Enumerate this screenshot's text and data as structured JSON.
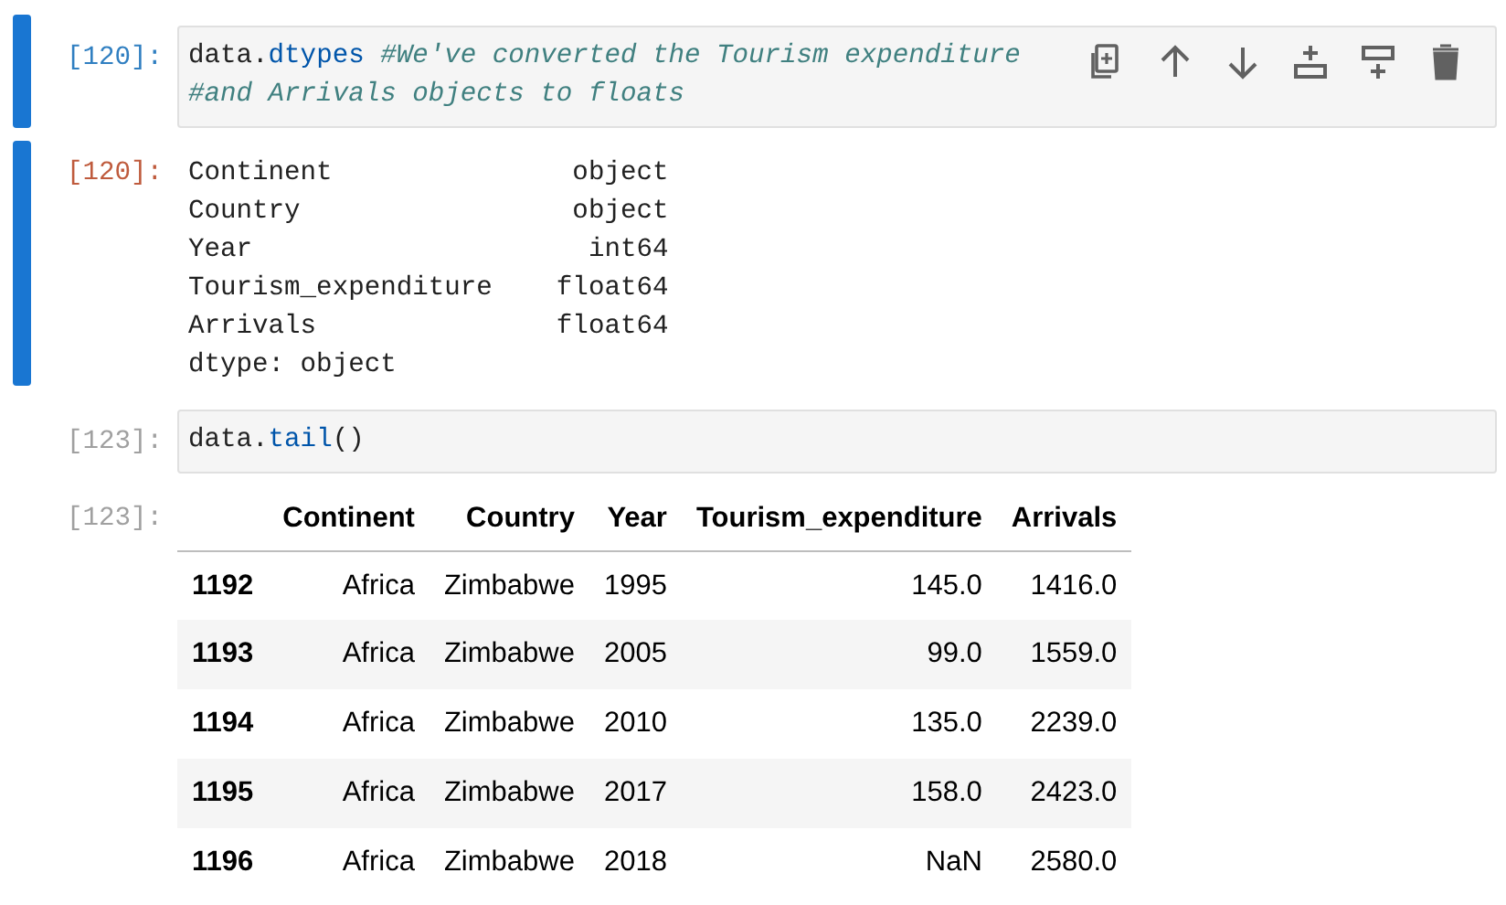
{
  "cells": [
    {
      "selected": true,
      "input": {
        "prompt": "[120]:",
        "lines": [
          [
            {
              "text": "data.",
              "kind": "plain"
            },
            {
              "text": "dtypes",
              "kind": "attr"
            },
            {
              "text": "#We've converted the Tourism expenditure",
              "kind": "comment"
            }
          ],
          [
            {
              "text": "#and Arrivals objects to floats",
              "kind": "comment"
            }
          ]
        ]
      },
      "toolbar": true,
      "output": {
        "prompt": "[120]:",
        "kind": "text",
        "lines": [
          "Continent               object",
          "Country                 object",
          "Year                     int64",
          "Tourism_expenditure    float64",
          "Arrivals               float64",
          "dtype: object"
        ]
      }
    },
    {
      "selected": false,
      "input": {
        "prompt": "[123]:",
        "lines": [
          [
            {
              "text": "data.",
              "kind": "plain"
            },
            {
              "text": "tail",
              "kind": "attr"
            },
            {
              "text": "()",
              "kind": "plain"
            }
          ]
        ]
      },
      "output": {
        "prompt": "[123]:",
        "kind": "table",
        "columns": [
          "Continent",
          "Country",
          "Year",
          "Tourism_expenditure",
          "Arrivals"
        ],
        "rows": [
          {
            "index": "1192",
            "cells": [
              "Africa",
              "Zimbabwe",
              "1995",
              "145.0",
              "1416.0"
            ]
          },
          {
            "index": "1193",
            "cells": [
              "Africa",
              "Zimbabwe",
              "2005",
              "99.0",
              "1559.0"
            ]
          },
          {
            "index": "1194",
            "cells": [
              "Africa",
              "Zimbabwe",
              "2010",
              "135.0",
              "2239.0"
            ]
          },
          {
            "index": "1195",
            "cells": [
              "Africa",
              "Zimbabwe",
              "2017",
              "158.0",
              "2423.0"
            ]
          },
          {
            "index": "1196",
            "cells": [
              "Africa",
              "Zimbabwe",
              "2018",
              "NaN",
              "2580.0"
            ]
          }
        ]
      }
    }
  ]
}
